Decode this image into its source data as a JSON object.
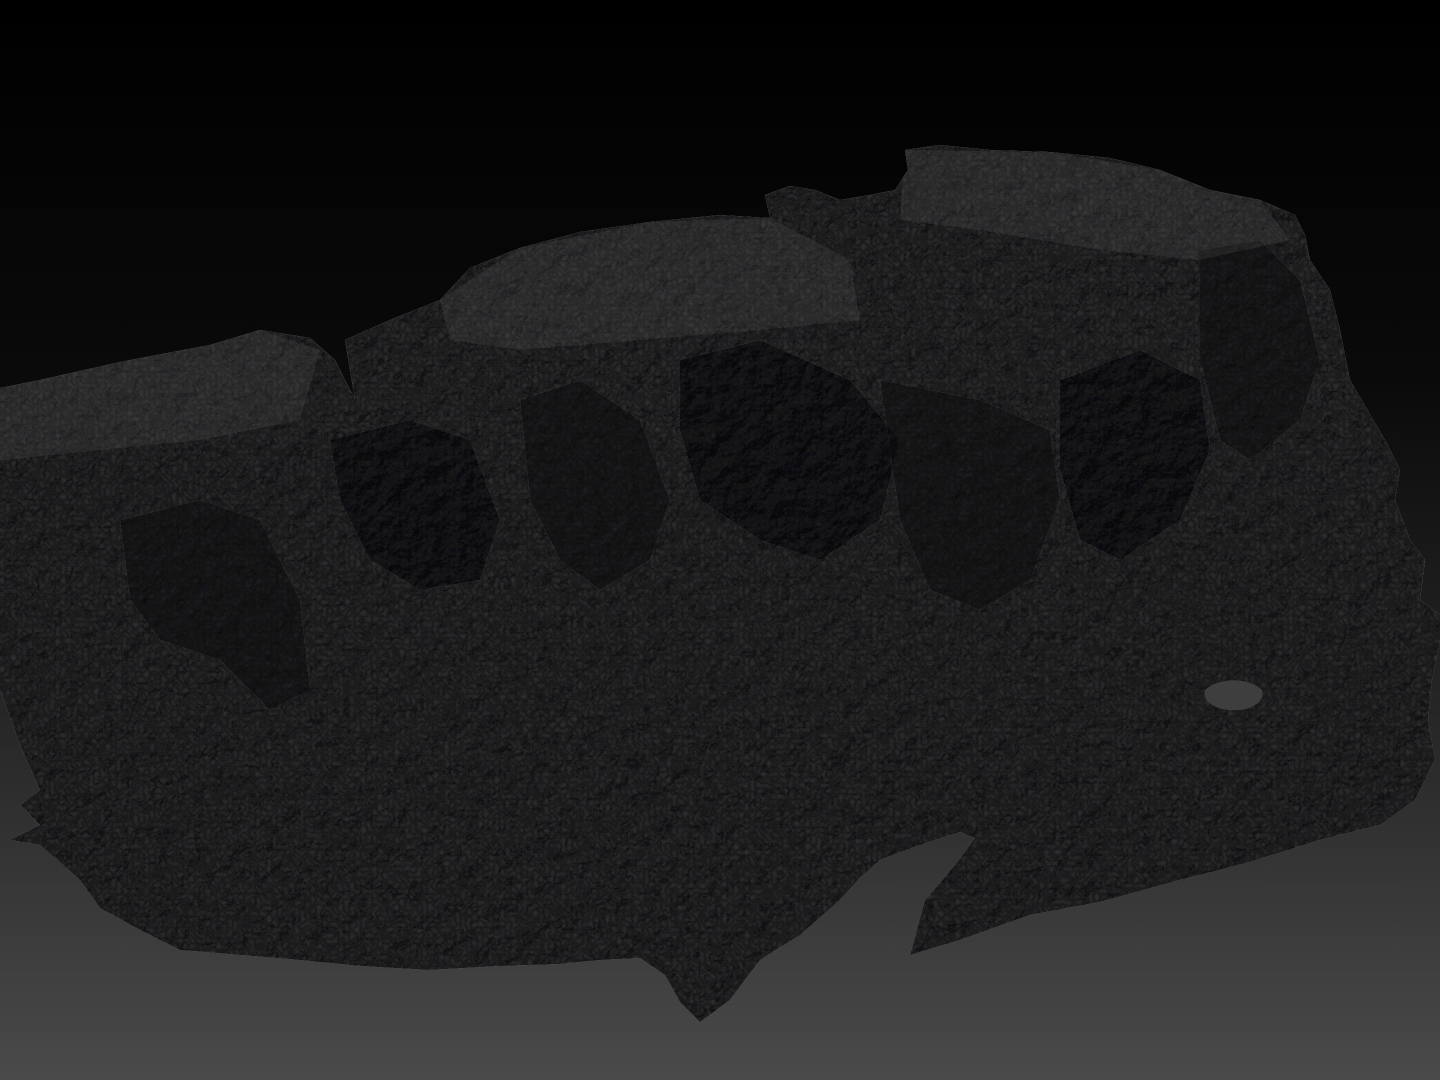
{
  "scene": {
    "subject": "rock-terrain-mesh",
    "colors": {
      "background_top": "#000000",
      "background_bottom": "#4a4a4a",
      "mesh_base": "#3a3a3c",
      "mesh_highlight": "#6a6a6c",
      "mesh_shadow": "#1c1c1e",
      "ledge_face": "#2e2e30"
    }
  }
}
